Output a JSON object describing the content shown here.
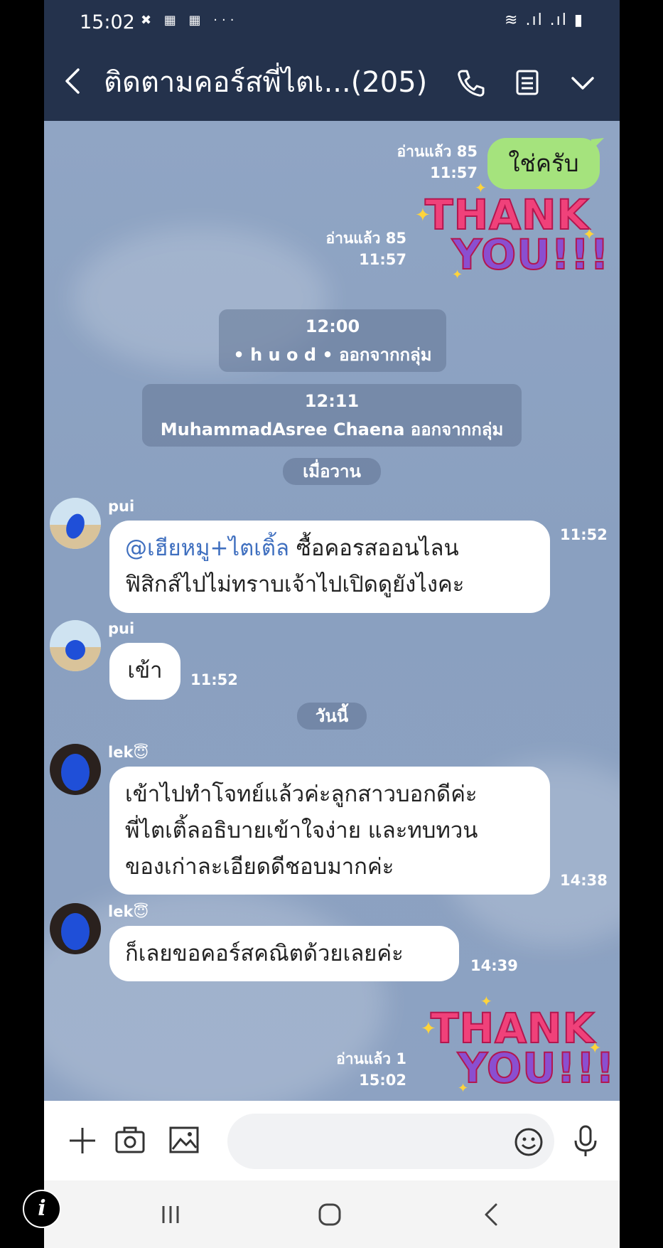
{
  "status_bar": {
    "time": "15:02",
    "left_icons": "✖ ▦ ▦ ···",
    "right_icons": "≋ .ıl .ıl ▮"
  },
  "header": {
    "title": "ติดตามคอร์สพี่ไตเ...(205)",
    "back_icon": "chevron-left-icon",
    "call_icon": "phone-icon",
    "notes_icon": "notes-icon",
    "menu_icon": "chevron-down-icon"
  },
  "messages": {
    "sent_1": {
      "read": "อ่านแล้ว 85",
      "time": "11:57",
      "text": "ใช่ครับ"
    },
    "sticker_1": {
      "read": "อ่านแล้ว 85",
      "time": "11:57",
      "line1": "THANK",
      "line2": "YOU!!!"
    },
    "system_1": {
      "time": "12:00",
      "text": "• h u o d • ออกจากกลุ่ม"
    },
    "system_2": {
      "time": "12:11",
      "text": "MuhammadAsree Chaena ออกจากกลุ่ม"
    },
    "date_yesterday": "เมื่อวาน",
    "pui_1": {
      "sender": "pui",
      "mention": "@เฮียหมู+ไตเติ้ล",
      "line1_rest": " ซื้อคอรสออนไลน",
      "line2": "ฟิสิกส์ไปไม่ทราบเจ้าไปเปิดดูยังไงคะ",
      "time": "11:52"
    },
    "pui_2": {
      "sender": "pui",
      "text": "เข้า",
      "time": "11:52"
    },
    "date_today": "วันนี้",
    "lek_1": {
      "sender": "lek😇",
      "line1": "เข้าไปทำโจทย์แล้วค่ะลูกสาวบอกดีค่ะ",
      "line2": "พี่ไตเติ้ลอธิบายเข้าใจง่าย และทบทวน",
      "line3": "ของเก่าละเอียดดีชอบมากค่ะ",
      "time": "14:38"
    },
    "lek_2": {
      "sender": "lek😇",
      "text": "ก็เลยขอคอร์สคณิตด้วยเลยค่ะ",
      "time": "14:39"
    },
    "sticker_2": {
      "read": "อ่านแล้ว 1",
      "time": "15:02",
      "line1": "THANK",
      "line2": "YOU!!!"
    }
  },
  "input_bar": {
    "placeholder": "",
    "icons": [
      "plus-icon",
      "camera-icon",
      "image-icon",
      "emoji-icon",
      "microphone-icon"
    ]
  },
  "nav_bar": {
    "icons": [
      "recent-apps-icon",
      "home-icon",
      "back-icon"
    ]
  },
  "overlay": {
    "info_label": "i"
  },
  "colors": {
    "header_bg": "#24324c",
    "chat_bg": "#8a9fbf",
    "sent_bubble": "#a5e37d",
    "received_bubble": "#ffffff",
    "mention": "#3f6fbf",
    "sticker_pink": "#f0417a",
    "sticker_purple": "#8a4fd0"
  }
}
